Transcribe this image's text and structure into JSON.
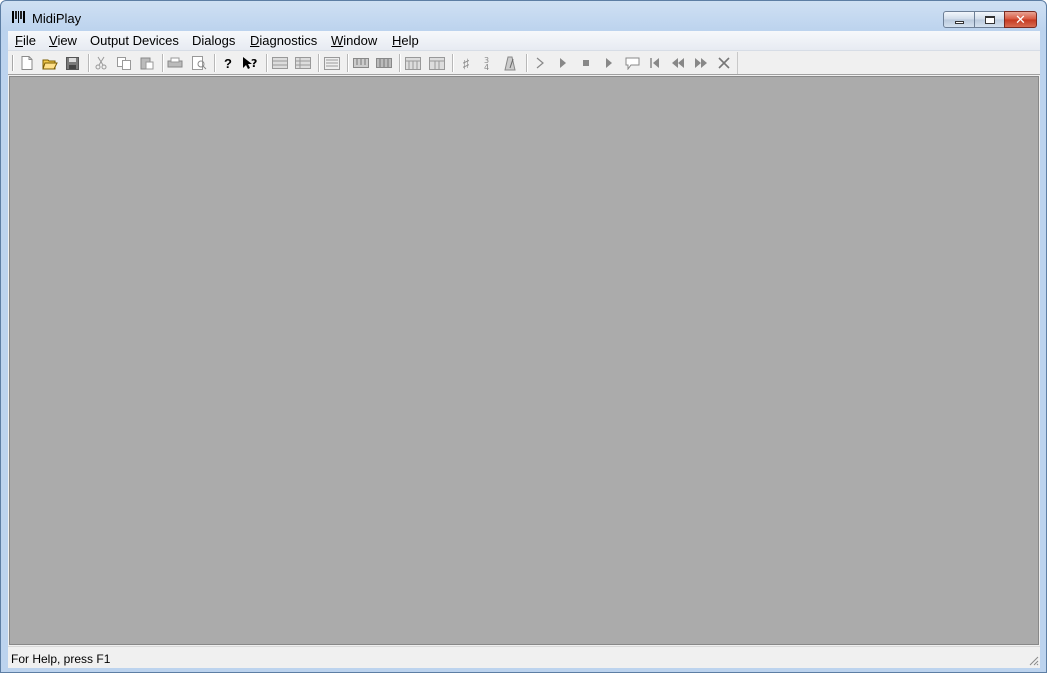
{
  "window": {
    "title": "MidiPlay",
    "minimize_label": "",
    "maximize_label": "",
    "close_label": "✕"
  },
  "menu": {
    "items": [
      {
        "label": "File",
        "accel": "F"
      },
      {
        "label": "View",
        "accel": "V"
      },
      {
        "label": "Output Devices",
        "accel": ""
      },
      {
        "label": "Dialogs",
        "accel": ""
      },
      {
        "label": "Diagnostics",
        "accel": "D"
      },
      {
        "label": "Window",
        "accel": "W"
      },
      {
        "label": "Help",
        "accel": "H"
      }
    ]
  },
  "toolbar": {
    "icons": [
      "new-file-icon",
      "open-folder-icon",
      "save-icon",
      "cut-icon",
      "copy-icon",
      "paste-icon",
      "print-icon",
      "print-preview-icon",
      "about-help-icon",
      "context-help-icon",
      "track-view-icon",
      "track-view-2-icon",
      "staff-view-icon",
      "keyboard-icon",
      "keyboard-2-icon",
      "piano-roll-icon",
      "piano-roll-2-icon",
      "sharp-icon",
      "time-signature-icon",
      "metronome-icon",
      "step-forward-icon",
      "play-icon",
      "stop-icon",
      "play-2-icon",
      "speech-icon",
      "rewind-start-icon",
      "rewind-icon",
      "fast-forward-icon",
      "close-x-icon"
    ]
  },
  "status": {
    "text": "For Help, press F1"
  },
  "colors": {
    "mdi_background": "#ababab",
    "title_gradient": "#bcd3ee",
    "close_button": "#c4381f"
  }
}
